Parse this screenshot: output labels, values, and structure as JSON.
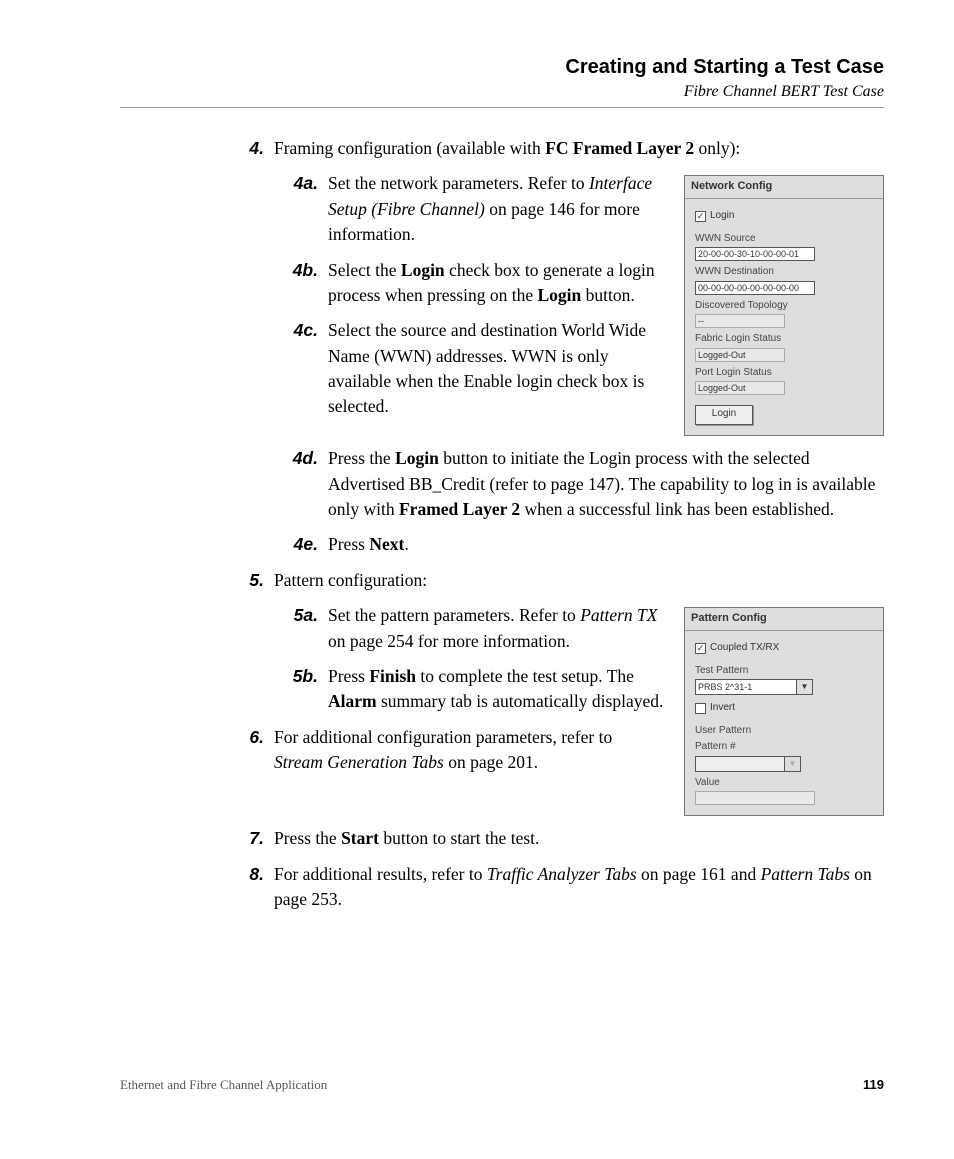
{
  "header": {
    "title": "Creating and Starting a Test Case",
    "subtitle": "Fibre Channel BERT Test Case"
  },
  "step4": {
    "num": "4.",
    "text_a": "Framing configuration (available with ",
    "text_b": "FC Framed Layer 2",
    "text_c": " only):"
  },
  "step4a": {
    "num": "4a.",
    "t1": "Set the network parameters. Refer to ",
    "t2": "Interface Setup (Fibre Channel)",
    "t3": " on page 146 for more information."
  },
  "step4b": {
    "num": "4b.",
    "t1": "Select the ",
    "t2": "Login",
    "t3": " check box to generate a login process when pressing on the ",
    "t4": "Login",
    "t5": " button."
  },
  "step4c": {
    "num": "4c.",
    "t1": "Select the source and destination World Wide Name (WWN) addresses. WWN is only available when the Enable login check box is selected."
  },
  "step4d": {
    "num": "4d.",
    "t1": "Press the ",
    "t2": "Login",
    "t3": " button to initiate the Login process with the selected Advertised BB_Credit (refer to page 147). The capability to log in is available only with ",
    "t4": "Framed Layer 2",
    "t5": " when a successful link has been established."
  },
  "step4e": {
    "num": "4e.",
    "t1": "Press ",
    "t2": "Next",
    "t3": "."
  },
  "step5": {
    "num": "5.",
    "text": "Pattern configuration:"
  },
  "step5a": {
    "num": "5a.",
    "t1": "Set the pattern parameters. Refer to ",
    "t2": "Pattern TX",
    "t3": " on page 254 for more information."
  },
  "step5b": {
    "num": "5b.",
    "t1": "Press ",
    "t2": "Finish",
    "t3": " to complete the test setup. The ",
    "t4": "Alarm",
    "t5": " summary tab is automatically displayed."
  },
  "step6": {
    "num": "6.",
    "t1": "For additional configuration parameters, refer to ",
    "t2": "Stream Generation Tabs",
    "t3": " on page 201."
  },
  "step7": {
    "num": "7.",
    "t1": "Press the ",
    "t2": "Start",
    "t3": " button to start the test."
  },
  "step8": {
    "num": "8.",
    "t1": "For additional results, refer to ",
    "t2": "Traffic Analyzer Tabs",
    "t3": " on page 161 and ",
    "t4": "Pattern Tabs",
    "t5": " on page 253."
  },
  "netbox": {
    "title": "Network Config",
    "login_chk_checked": "✓",
    "login_label": "Login",
    "wwn_src_label": "WWN Source",
    "wwn_src_val": "20-00-00-30-10-00-00-01",
    "wwn_dst_label": "WWN Destination",
    "wwn_dst_val": "00-00-00-00-00-00-00-00",
    "disc_topo_label": "Discovered Topology",
    "disc_topo_val": "--",
    "fabric_label": "Fabric Login Status",
    "fabric_val": "Logged-Out",
    "port_label": "Port Login Status",
    "port_val": "Logged-Out",
    "login_btn": "Login"
  },
  "patbox": {
    "title": "Pattern Config",
    "coupled_chk": "✓",
    "coupled_label": "Coupled TX/RX",
    "test_pat_label": "Test Pattern",
    "test_pat_val": "PRBS 2^31-1",
    "invert_label": "Invert",
    "user_pat_label": "User Pattern",
    "patnum_label": "Pattern #",
    "patnum_val": "",
    "value_label": "Value",
    "value_val": ""
  },
  "footer": {
    "left": "Ethernet and Fibre Channel Application",
    "page": "119"
  }
}
